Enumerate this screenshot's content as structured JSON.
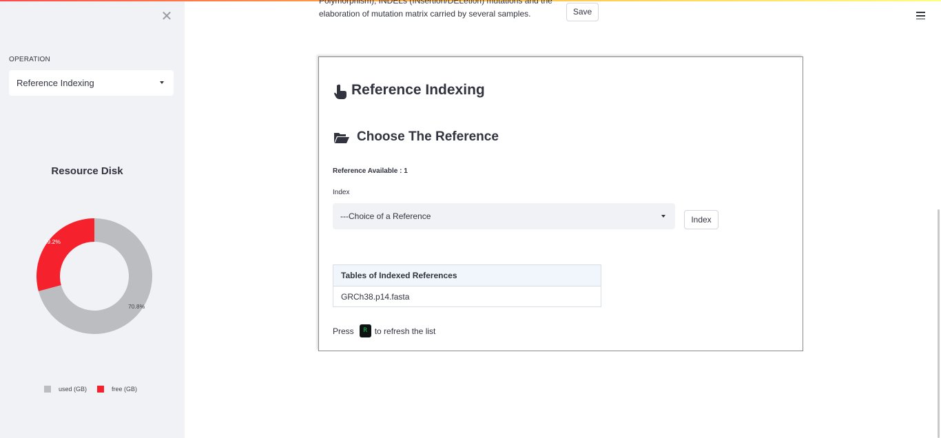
{
  "intro": {
    "line1": "Polymorphism), INDELs (INsertion/DELetion) mutations and the",
    "line2": "elaboration of mutation matrix carried by several samples."
  },
  "header": {
    "save_label": "Save",
    "menu_icon": "hamburger-icon"
  },
  "sidebar": {
    "close_icon": "close-icon",
    "operation_label": "OPERATION",
    "operation_selected": "Reference Indexing",
    "chart_title": "Resource Disk"
  },
  "chart_data": {
    "type": "pie",
    "title": "Resource Disk",
    "series": [
      {
        "name": "used (GB)",
        "value": 70.8,
        "label": "70.8%",
        "color": "#bcbdc0"
      },
      {
        "name": "free (GB)",
        "value": 29.2,
        "label": "29.2%",
        "color": "#f5222d"
      }
    ],
    "legend": "bottom"
  },
  "main": {
    "title": "Reference Indexing",
    "title_icon": "pointing-hand-icon",
    "section_title": "Choose The Reference",
    "section_icon": "open-folder-icon",
    "reference_available": "Reference Available : 1",
    "index_label": "Index",
    "index_selected": "---Choice of a Reference",
    "index_button": "Index",
    "table": {
      "header": "Tables of Indexed References",
      "rows": [
        "GRCh38.p14.fasta"
      ]
    },
    "refresh": {
      "prefix": "Press",
      "key": "R",
      "suffix": "to refresh the list"
    }
  }
}
